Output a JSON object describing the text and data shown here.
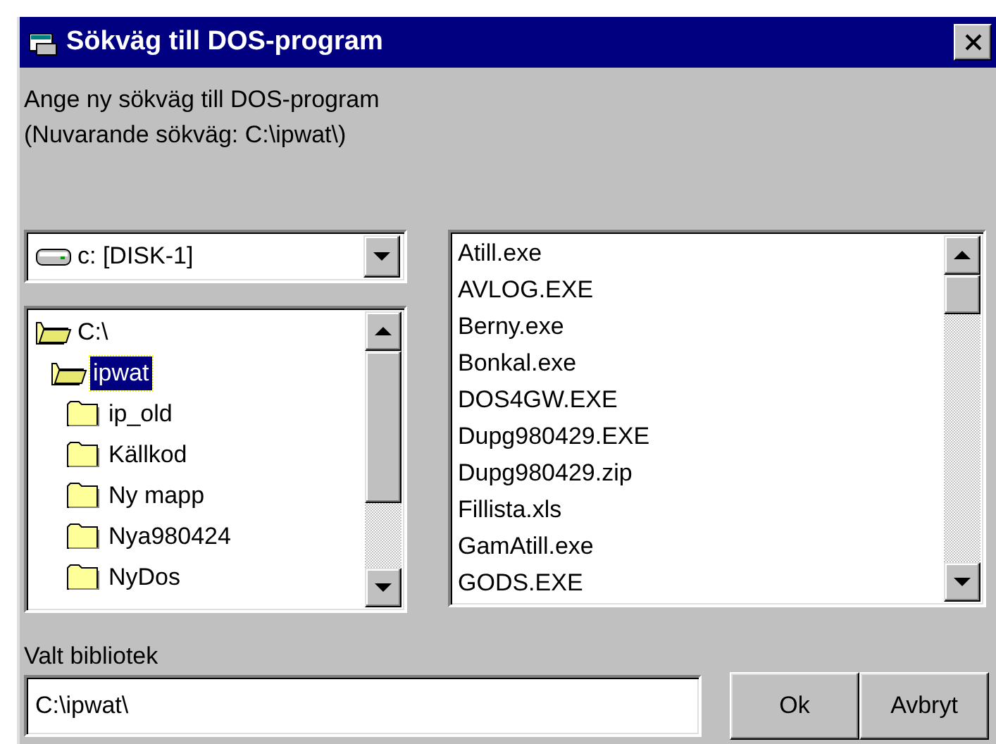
{
  "window": {
    "title": "Sökväg till DOS-program"
  },
  "description": [
    "Ange ny sökväg till DOS-program",
    "(Nuvarande sökväg: C:\\ipwat\\)"
  ],
  "drive": {
    "label": "c: [DISK-1]"
  },
  "folders": [
    {
      "label": "C:\\",
      "expanded": true,
      "selected": false,
      "children": [
        {
          "label": "ipwat",
          "expanded": true,
          "selected": true,
          "children": [
            {
              "label": "ip_old",
              "expanded": false,
              "selected": false
            },
            {
              "label": "Källkod",
              "expanded": false,
              "selected": false
            },
            {
              "label": "Ny mapp",
              "expanded": false,
              "selected": false
            },
            {
              "label": "Nya980424",
              "expanded": false,
              "selected": false
            },
            {
              "label": "NyDos",
              "expanded": false,
              "selected": false
            }
          ]
        }
      ]
    }
  ],
  "files": [
    "Atill.exe",
    "AVLOG.EXE",
    "Berny.exe",
    "Bonkal.exe",
    "DOS4GW.EXE",
    "Dupg980429.EXE",
    "Dupg980429.zip",
    "Fillista.xls",
    "GamAtill.exe",
    "GODS.EXE"
  ],
  "selected_folder": {
    "label": "Valt bibliotek",
    "value": "C:\\ipwat\\"
  },
  "buttons": [
    "Ok",
    "Avbryt"
  ]
}
